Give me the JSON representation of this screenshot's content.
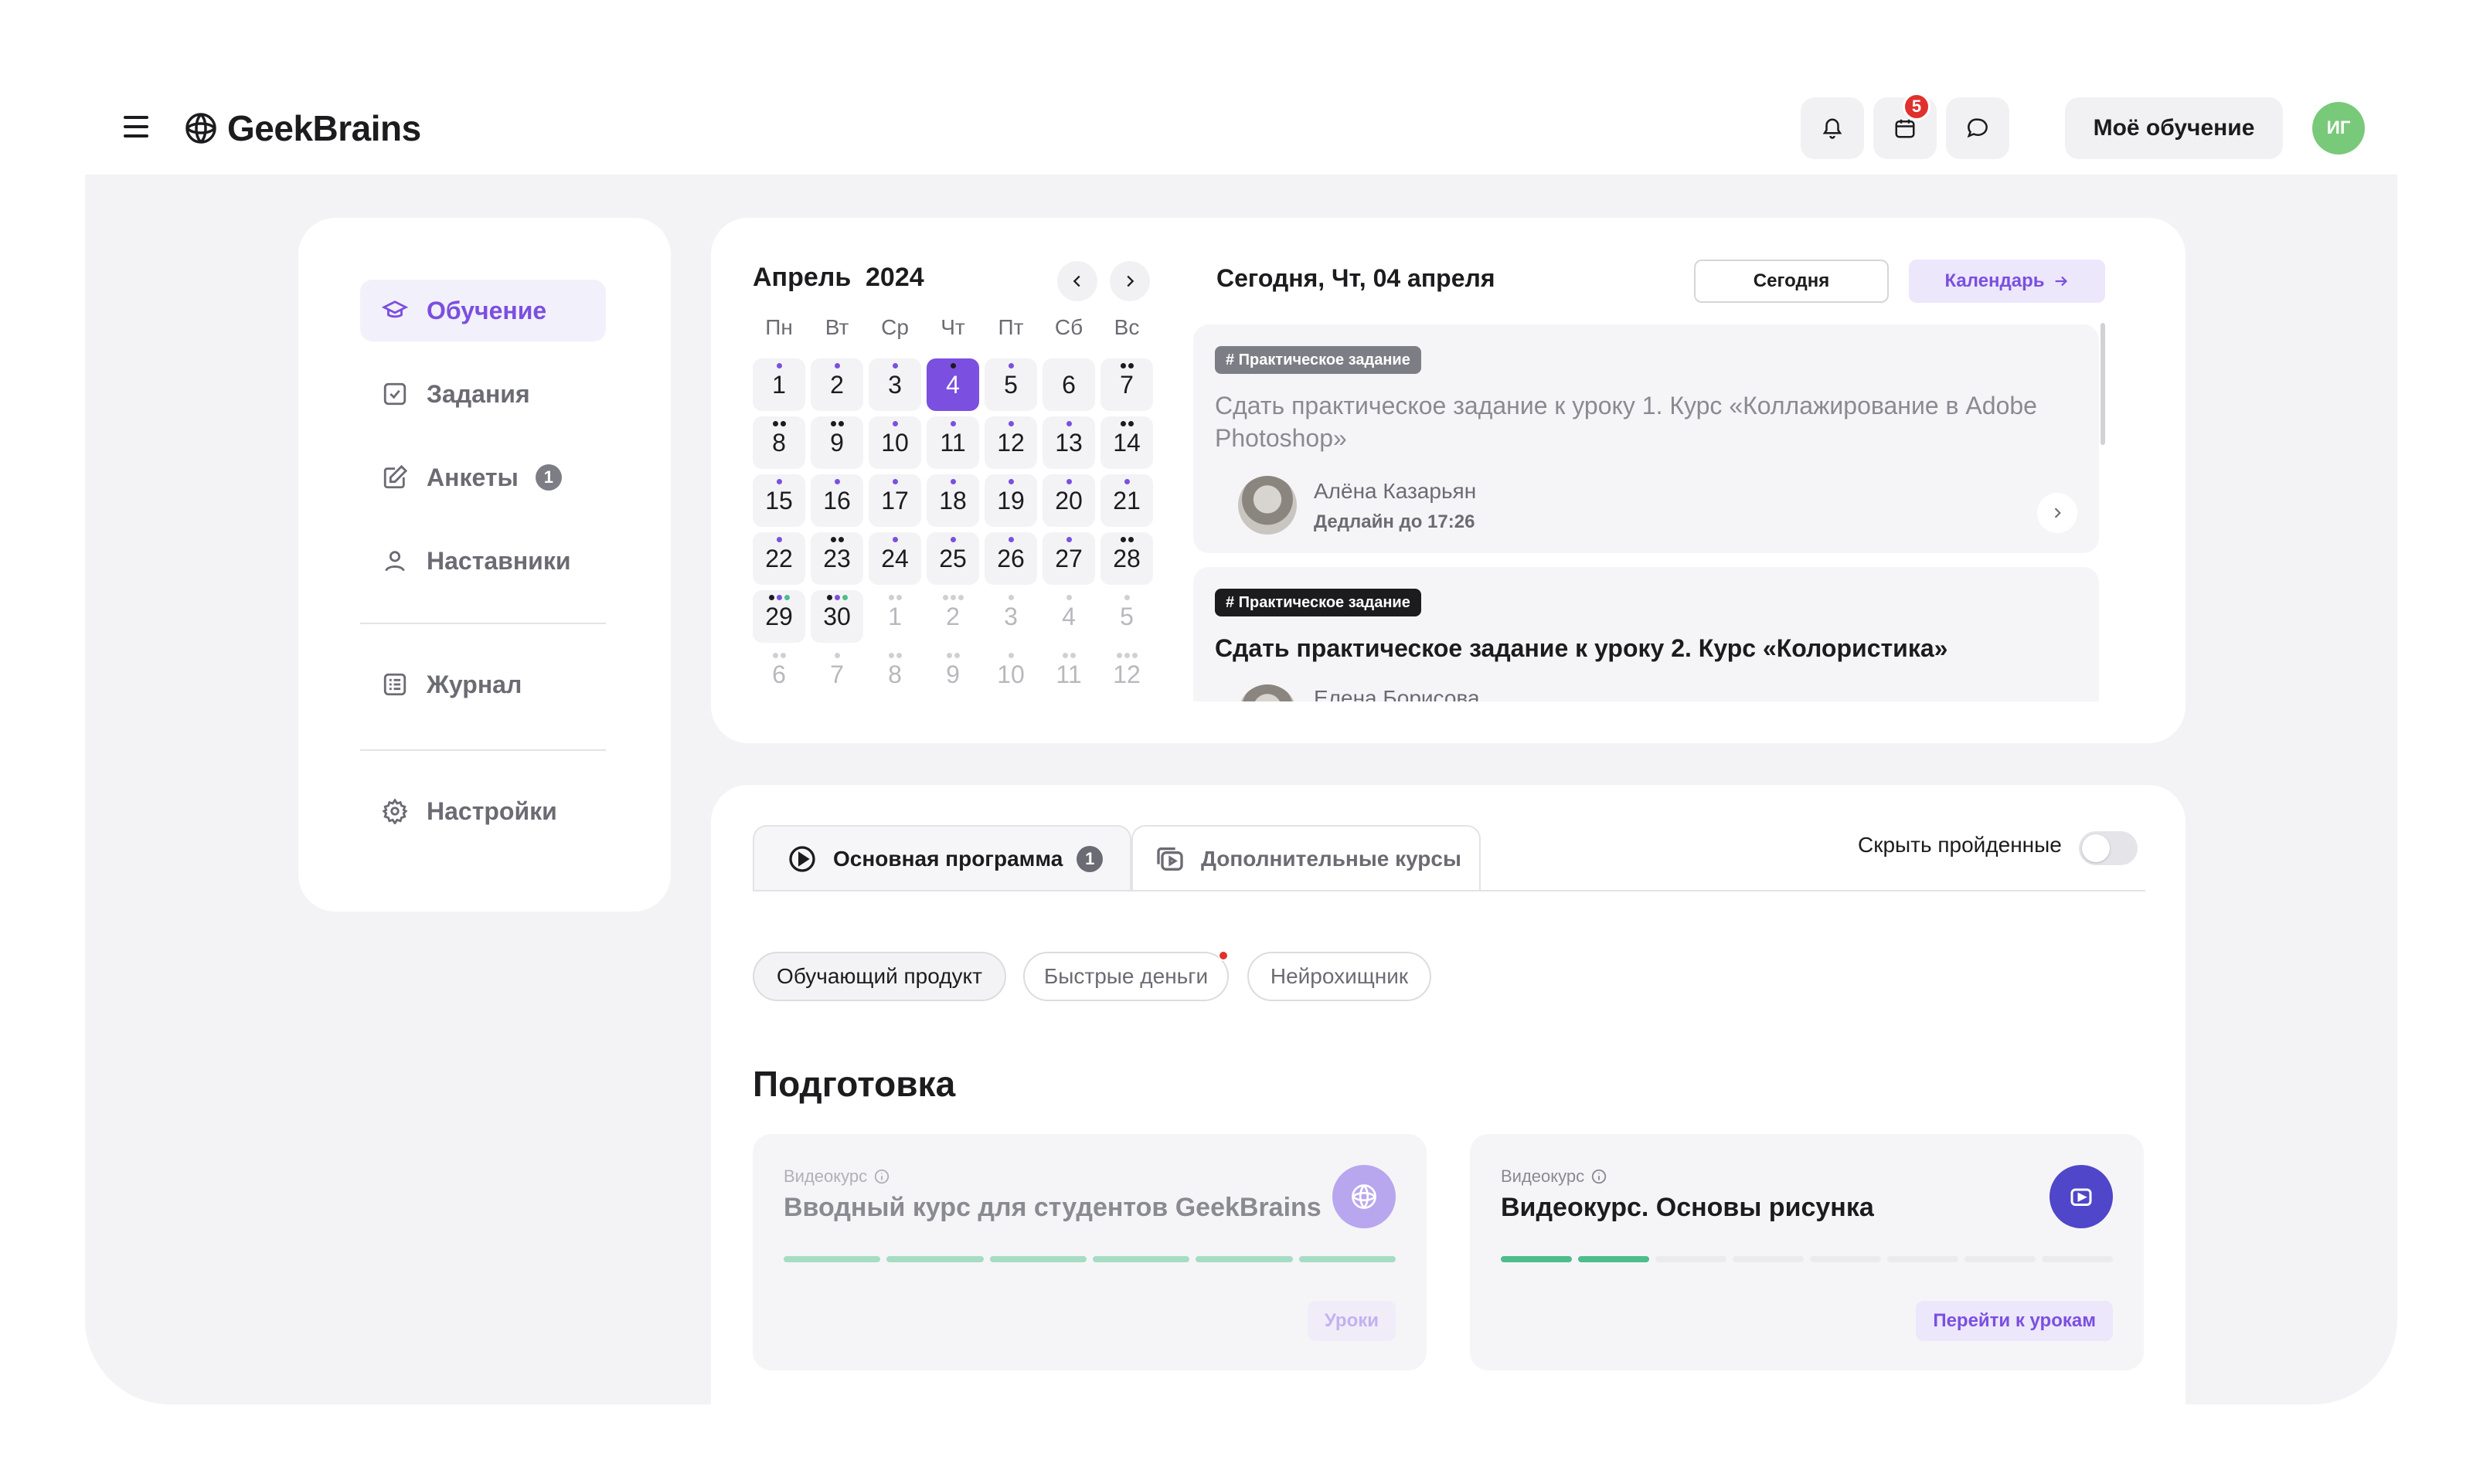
{
  "header": {
    "logo_text": "GeekBrains",
    "calendar_badge": "5",
    "my_learning_label": "Моё обучение",
    "avatar_initials": "ИГ"
  },
  "sidebar": {
    "items": [
      {
        "label": "Обучение",
        "icon": "graduation-cap-icon",
        "active": true
      },
      {
        "label": "Задания",
        "icon": "checkbox-icon"
      },
      {
        "label": "Анкеты",
        "icon": "edit-form-icon",
        "badge": "1"
      },
      {
        "label": "Наставники",
        "icon": "user-icon"
      },
      {
        "label": "Журнал",
        "icon": "journal-icon"
      },
      {
        "label": "Настройки",
        "icon": "gear-icon"
      }
    ]
  },
  "calendar": {
    "month": "Апрель",
    "year": "2024",
    "weekdays": [
      "Пн",
      "Вт",
      "Ср",
      "Чт",
      "Пт",
      "Сб",
      "Вс"
    ],
    "today_day": "4",
    "weeks": [
      [
        "1",
        "2",
        "3",
        "4",
        "5",
        "6",
        "7"
      ],
      [
        "8",
        "9",
        "10",
        "11",
        "12",
        "13",
        "14"
      ],
      [
        "15",
        "16",
        "17",
        "18",
        "19",
        "20",
        "21"
      ],
      [
        "22",
        "23",
        "24",
        "25",
        "26",
        "27",
        "28"
      ],
      [
        "29",
        "30",
        "1",
        "2",
        "3",
        "4",
        "5"
      ],
      [
        "6",
        "7",
        "8",
        "9",
        "10",
        "11",
        "12"
      ]
    ]
  },
  "agenda": {
    "title": "Сегодня, Чт, 04 апреля",
    "today_button": "Сегодня",
    "calendar_button": "Календарь",
    "tasks": [
      {
        "tag": "# Практическое задание",
        "title": "Сдать практическое задание к уроку 1. Курс «Коллажирование в Adobe Photoshop»",
        "mentor": "Алёна Казарьян",
        "deadline": "Дедлайн до 17:26"
      },
      {
        "tag": "# Практическое задание",
        "title": "Сдать практическое задание к уроку 2. Курс «Колористика»",
        "mentor": "Елена Борисова"
      }
    ]
  },
  "program": {
    "tabs": [
      {
        "label": "Основная программа",
        "badge": "1",
        "active": true
      },
      {
        "label": "Дополнительные курсы",
        "active": false
      }
    ],
    "hide_completed_label": "Скрыть пройденные",
    "filters": [
      "Обучающий продукт",
      "Быстрые деньги",
      "Нейрохищник"
    ],
    "section_title": "Подготовка",
    "courses": [
      {
        "type": "Видеокурс",
        "title": "Вводный курс для студентов GeekBrains",
        "button": "Уроки",
        "progress_filled": 6,
        "progress_total": 6
      },
      {
        "type": "Видеокурс",
        "title": "Видеокурс. Основы рисунка",
        "button": "Перейти к урокам",
        "progress_filled": 2,
        "progress_total": 8
      }
    ]
  },
  "colors": {
    "accent": "#7b4fe0",
    "badge_red": "#e0312c",
    "progress_green": "#4dbd8c",
    "avatar_green": "#79c97a"
  }
}
